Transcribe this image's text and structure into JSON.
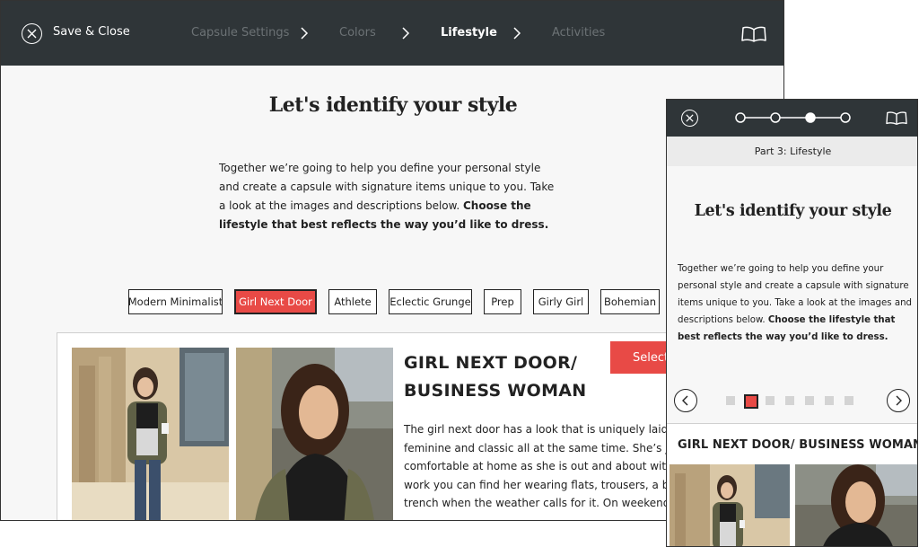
{
  "desktop": {
    "header": {
      "save_close_label": "Save & Close",
      "steps": [
        "Capsule Settings",
        "Colors",
        "Lifestyle",
        "Activities"
      ],
      "active_step": "Lifestyle",
      "close_icon": "close-icon",
      "guide_icon": "open-book-icon"
    },
    "heading": "Let's identify your style",
    "intro_text": "Together we’re going to help you define your personal style and create a capsule with signature items unique to you. Take a look at the images and descriptions below. ",
    "intro_bold": "Choose the lifestyle that best reflects the way you’d like to dress.",
    "lifestyle_tabs": [
      "Modern Minimalist",
      "Girl Next Door",
      "Athlete",
      "Eclectic Grunge",
      "Prep",
      "Girly Girl",
      "Bohemian"
    ],
    "selected_tab": "Girl Next Door",
    "card": {
      "title_line1": "GIRL NEXT DOOR/",
      "title_line2": "BUSINESS WOMAN",
      "select_label": "Selecte",
      "body_lines": [
        "The girl next door has a look that is uniquely laid back, but",
        "feminine and classic all at the same time. She’s just as",
        "comfortable at home as she is out and about with her frie",
        "work you can find her wearing flats, trousers, a button up,",
        "trench when the weather calls for it. On weekends she’ll o"
      ]
    }
  },
  "mobile": {
    "header": {
      "close_icon": "close-icon",
      "guide_icon": "open-book-icon",
      "progress_steps": 4,
      "progress_current": 3
    },
    "part_label": "Part 3: Lifestyle",
    "heading": "Let's identify your style",
    "intro_text": "Together we’re going to help you define your personal style and create a capsule with signature items unique to you. Take a look at the images and descriptions below. ",
    "intro_bold": "Choose the lifestyle that best reflects the way you’d like to dress.",
    "carousel": {
      "total": 7,
      "current": 2,
      "prev_icon": "chevron-left-icon",
      "next_icon": "chevron-right-icon"
    },
    "card_title": "GIRL NEXT DOOR/ BUSINESS WOMAN"
  },
  "colors": {
    "header_bg": "#2f3538",
    "accent": "#e84a46",
    "page_bg": "#f7f7f7"
  }
}
